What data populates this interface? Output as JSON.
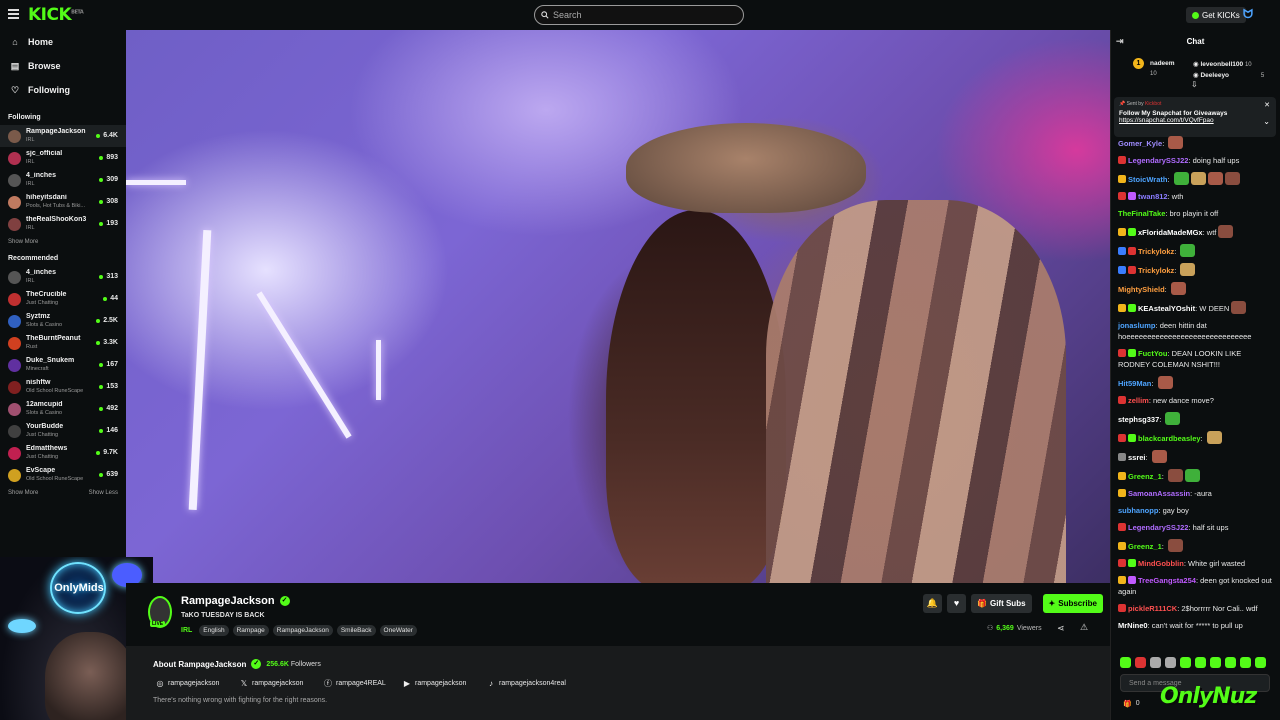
{
  "brand": {
    "logo_text": "KICK",
    "logo_sup": "BETA",
    "accent": "#53fc18"
  },
  "search": {
    "placeholder": "Search"
  },
  "topbar": {
    "get_kicks": "Get KICKs"
  },
  "nav": [
    {
      "label": "Home",
      "icon": "home-icon"
    },
    {
      "label": "Browse",
      "icon": "browse-icon"
    },
    {
      "label": "Following",
      "icon": "heart-icon"
    }
  ],
  "following": {
    "title": "Following",
    "channels": [
      {
        "name": "RampageJackson",
        "category": "IRL",
        "viewers": "6.4K",
        "color": "#7a5a4a"
      },
      {
        "name": "sjc_official",
        "category": "IRL",
        "viewers": "893",
        "color": "#b03050"
      },
      {
        "name": "4_inches",
        "category": "IRL",
        "viewers": "309",
        "color": "#555"
      },
      {
        "name": "hiheyitsdani",
        "category": "Pools, Hot Tubs & Biki...",
        "viewers": "308",
        "color": "#c07a60"
      },
      {
        "name": "theRealShooKon3",
        "category": "IRL",
        "viewers": "193",
        "color": "#804040"
      }
    ],
    "show_more": "Show More"
  },
  "recommended": {
    "title": "Recommended",
    "channels": [
      {
        "name": "4_inches",
        "category": "IRL",
        "viewers": "313",
        "color": "#555"
      },
      {
        "name": "TheCrucible",
        "category": "Just Chatting",
        "viewers": "44",
        "color": "#c03030"
      },
      {
        "name": "Syztmz",
        "category": "Slots & Casino",
        "viewers": "2.5K",
        "color": "#3060c0"
      },
      {
        "name": "TheBurntPeanut",
        "category": "Rust",
        "viewers": "3.3K",
        "color": "#d04020"
      },
      {
        "name": "Duke_Snukem",
        "category": "Minecraft",
        "viewers": "167",
        "color": "#6030a0"
      },
      {
        "name": "nishftw",
        "category": "Old School RuneScape",
        "viewers": "153",
        "color": "#802020"
      },
      {
        "name": "12amcupid",
        "category": "Slots & Casino",
        "viewers": "492",
        "color": "#a05070"
      },
      {
        "name": "YourBudde",
        "category": "Just Chatting",
        "viewers": "146",
        "color": "#404040"
      },
      {
        "name": "Edmatthews",
        "category": "Just Chatting",
        "viewers": "9.7K",
        "color": "#c02050"
      },
      {
        "name": "EvScape",
        "category": "Old School RuneScape",
        "viewers": "639",
        "color": "#d0a020"
      }
    ],
    "show_more": "Show More",
    "show_less": "Show Less"
  },
  "webcam": {
    "neon_text": "OnlyMids"
  },
  "stream": {
    "streamer": "RampageJackson",
    "title": "TaKO TUESDAY IS BACK",
    "category": "IRL",
    "live_label": "LIVE",
    "tags": [
      "English",
      "Rampage",
      "RampageJackson",
      "SmileBack",
      "OneWater"
    ],
    "gift_label": "Gift Subs",
    "subscribe_label": "Subscribe",
    "viewers": "6,369",
    "viewers_label": "Viewers"
  },
  "about": {
    "title": "About RampageJackson",
    "followers": "256.6K",
    "followers_label": "Followers",
    "socials": [
      {
        "icon": "instagram-icon",
        "glyph": "◎",
        "handle": "rampagejackson"
      },
      {
        "icon": "x-icon",
        "glyph": "𝕏",
        "handle": "rampagejackson"
      },
      {
        "icon": "facebook-icon",
        "glyph": "ⓕ",
        "handle": "rampage4REAL"
      },
      {
        "icon": "youtube-icon",
        "glyph": "▶",
        "handle": "rampagejackson"
      },
      {
        "icon": "tiktok-icon",
        "glyph": "♪",
        "handle": "rampagejackson4real"
      }
    ],
    "bio": "There's nothing wrong with fighting for the right reasons."
  },
  "chat": {
    "title": "Chat",
    "leaders": [
      {
        "name": "nadeem",
        "count": "10"
      },
      {
        "name": "leveonbell100",
        "count": "10"
      },
      {
        "name": "Deeleeyo",
        "count": "5"
      }
    ],
    "pinned": {
      "sent_by": "Sent by",
      "sender": "Kickbot",
      "message": "Follow My Snapchat for Giveaways",
      "link": "https://snapchat.com/t/VQvfFpao"
    },
    "messages": [
      {
        "user": "Gomer_Kyle",
        "color": "#9f8cff",
        "text": "",
        "badges": [],
        "emotes": 1
      },
      {
        "user": "LegendarySSJ22",
        "color": "#b06cff",
        "text": "doing half ups",
        "badges": [
          "#d33"
        ],
        "emotes": 0
      },
      {
        "user": "StoicWrath",
        "color": "#4ea4ff",
        "text": "",
        "badges": [
          "#f2b51b"
        ],
        "emotes": 4
      },
      {
        "user": "twan812",
        "color": "#8a7cff",
        "text": "wth",
        "badges": [
          "#d33",
          "#c05aff"
        ],
        "emotes": 0
      },
      {
        "user": "TheFinalTake",
        "color": "#53fc18",
        "text": "bro playin it off",
        "badges": [],
        "emotes": 0
      },
      {
        "user": "xFloridaMadeMGx",
        "color": "#ffffff",
        "text": "wtf",
        "badges": [
          "#f2b51b",
          "#53fc18"
        ],
        "emotes": 1
      },
      {
        "user": "Trickylokz",
        "color": "#ff9f40",
        "text": "",
        "badges": [
          "#3a7dff",
          "#d33"
        ],
        "emotes": 1
      },
      {
        "user": "Trickylokz",
        "color": "#ff9f40",
        "text": "",
        "badges": [
          "#3a7dff",
          "#d33"
        ],
        "emotes": 1
      },
      {
        "user": "MightyShield",
        "color": "#ff9f40",
        "text": "",
        "badges": [],
        "emotes": 1
      },
      {
        "user": "KEAstealYOshit",
        "color": "#ffffff",
        "text": "W DEEN",
        "badges": [
          "#f2b51b",
          "#53fc18"
        ],
        "emotes": 1
      },
      {
        "user": "jonaslump",
        "color": "#4ea4ff",
        "text": "deen hittin dat hoeeeeeeeeeeeeeeeeeeeeeeeeeeeeee",
        "badges": [],
        "emotes": 0
      },
      {
        "user": "FuctYou",
        "color": "#53fc18",
        "text": "DEAN LOOKIN LIKE RODNEY COLEMAN NSHIT!!!",
        "badges": [
          "#d33",
          "#53fc18"
        ],
        "emotes": 0
      },
      {
        "user": "Hit59Man",
        "color": "#4ea4ff",
        "text": "",
        "badges": [],
        "emotes": 1
      },
      {
        "user": "zellim",
        "color": "#ff5050",
        "text": "new dance move?",
        "badges": [
          "#d33"
        ],
        "emotes": 0
      },
      {
        "user": "stephsg337",
        "color": "#ffffff",
        "text": "",
        "badges": [],
        "emotes": 1
      },
      {
        "user": "blackcardbeasley",
        "color": "#53fc18",
        "text": "",
        "badges": [
          "#d33",
          "#53fc18"
        ],
        "emotes": 1
      },
      {
        "user": "ssrei",
        "color": "#ffffff",
        "text": "",
        "badges": [
          "#888"
        ],
        "emotes": 1
      },
      {
        "user": "Greenz_1",
        "color": "#53fc18",
        "text": "",
        "badges": [
          "#f2b51b"
        ],
        "emotes": 2
      },
      {
        "user": "SamoanAssassin",
        "color": "#b06cff",
        "text": "-aura",
        "badges": [
          "#f2b51b"
        ],
        "emotes": 0
      },
      {
        "user": "subhanopp",
        "color": "#4ea4ff",
        "text": "gay boy",
        "badges": [],
        "emotes": 0
      },
      {
        "user": "LegendarySSJ22",
        "color": "#b06cff",
        "text": "half sit ups",
        "badges": [
          "#d33"
        ],
        "emotes": 0
      },
      {
        "user": "Greenz_1",
        "color": "#53fc18",
        "text": "",
        "badges": [
          "#f2b51b"
        ],
        "emotes": 1
      },
      {
        "user": "MindGobblin",
        "color": "#ff5050",
        "text": "White girl wasted",
        "badges": [
          "#d33",
          "#53fc18"
        ],
        "emotes": 0
      },
      {
        "user": "TreeGangsta254",
        "color": "#c05aff",
        "text": "deen got knocked out again",
        "badges": [
          "#f2b51b",
          "#c05aff"
        ],
        "emotes": 0
      },
      {
        "user": "pickleR111CK",
        "color": "#ff5050",
        "text": "2$horrrrr Nor Cali.. wdf",
        "badges": [
          "#d33"
        ],
        "emotes": 0
      },
      {
        "user": "MrNine0",
        "color": "#ffffff",
        "text": "can't wait for ***** to pull up",
        "badges": [],
        "emotes": 0
      }
    ],
    "input_placeholder": "Send a message",
    "kicks_count": "0"
  },
  "watermark": "OnlyNuz"
}
